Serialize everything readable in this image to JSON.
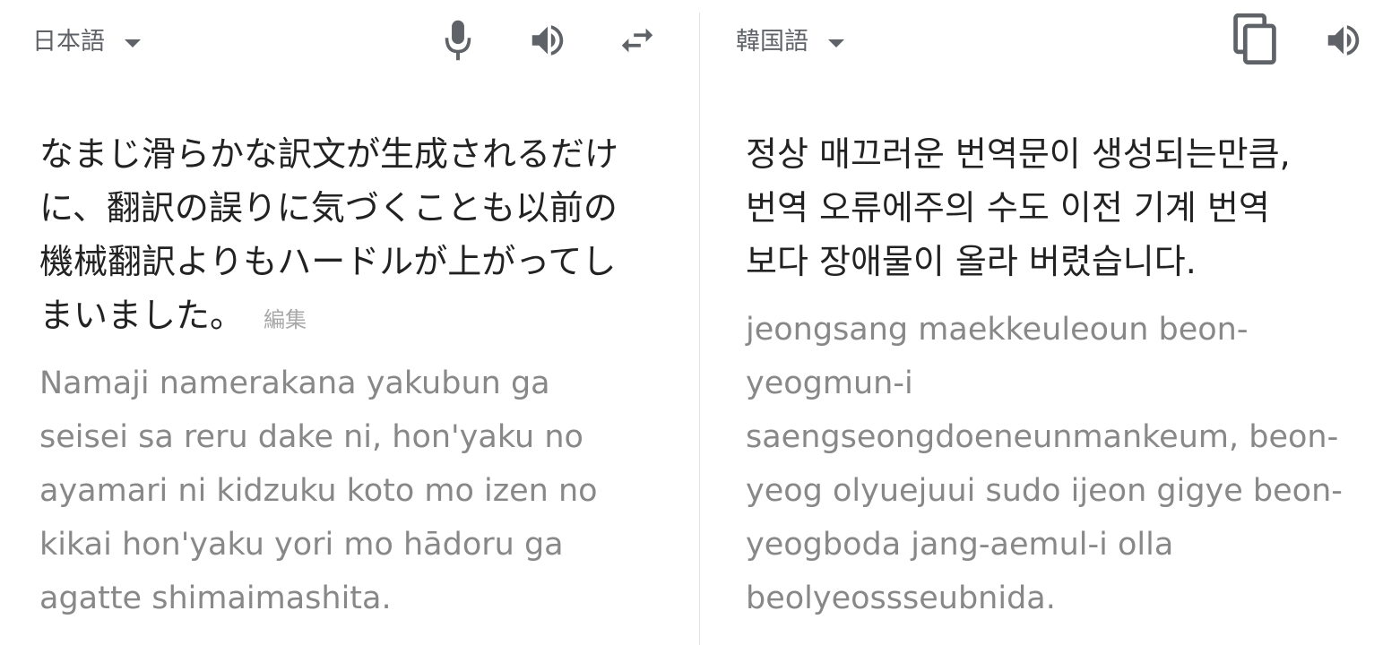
{
  "source": {
    "language": "日本語",
    "lines": [
      "なまじ滑らかな訳文が生成されるだけ",
      "に、翻訳の誤りに気づくことも以前の",
      "機械翻訳よりもハードルが上がってし",
      "まいました。"
    ],
    "edit_label": "編集",
    "transliteration": [
      "Namaji namerakana yakubun ga",
      "seisei sa reru dake ni, hon'yaku no",
      "ayamari ni kidzuku koto mo izen no",
      "kikai hon'yaku yori mo hādoru ga",
      "agatte shimaimashita."
    ]
  },
  "target": {
    "language": "韓国語",
    "lines": [
      "정상 매끄러운 번역문이 생성되는만큼,",
      "번역 오류에주의 수도 이전 기계 번역",
      "보다 장애물이 올라 버렸습니다."
    ],
    "transliteration": [
      "jeongsang maekkeuleoun beon-",
      "yeogmun-i",
      "saengseongdoeneunmankeum, beon-",
      "yeog olyuejuui sudo ijeon gigye beon-",
      "yeogboda jang-aemul-i olla",
      "beolyeossseubnida."
    ]
  },
  "icons": {
    "mic": "microphone-icon",
    "speaker": "speaker-icon",
    "swap": "swap-languages-icon",
    "copy": "copy-icon"
  },
  "colors": {
    "icon": "#5f6368",
    "main_text": "#222222",
    "transliteration": "#888888",
    "edit_link": "#a8a8a8",
    "divider": "#e3e3e3"
  }
}
